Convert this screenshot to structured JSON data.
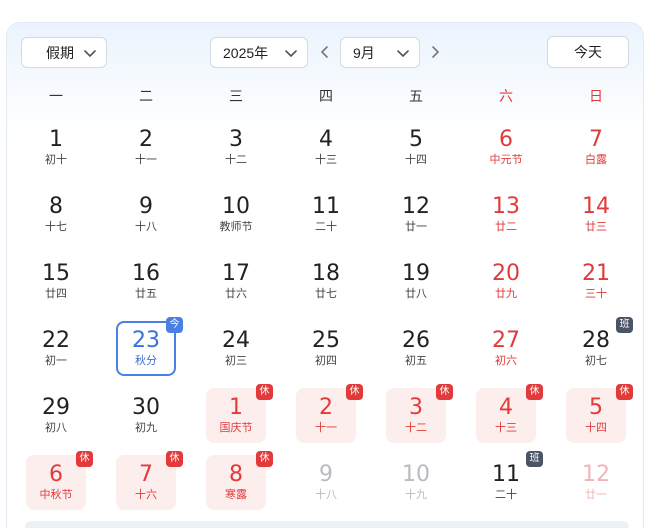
{
  "toolbar": {
    "holiday_label": "假期",
    "year_label": "2025年",
    "month_label": "9月",
    "today_label": "今天"
  },
  "weekdays": [
    "一",
    "二",
    "三",
    "四",
    "五",
    "六",
    "日"
  ],
  "badges": {
    "rest": "休",
    "work": "班",
    "today": "今"
  },
  "weeks": [
    [
      {
        "day": "1",
        "sub": "初十"
      },
      {
        "day": "2",
        "sub": "十一"
      },
      {
        "day": "3",
        "sub": "十二"
      },
      {
        "day": "4",
        "sub": "十三"
      },
      {
        "day": "5",
        "sub": "十四"
      },
      {
        "day": "6",
        "sub": "中元节",
        "red": true
      },
      {
        "day": "7",
        "sub": "白露",
        "red": true
      }
    ],
    [
      {
        "day": "8",
        "sub": "十七"
      },
      {
        "day": "9",
        "sub": "十八"
      },
      {
        "day": "10",
        "sub": "教师节"
      },
      {
        "day": "11",
        "sub": "二十"
      },
      {
        "day": "12",
        "sub": "廿一"
      },
      {
        "day": "13",
        "sub": "廿二",
        "red": true
      },
      {
        "day": "14",
        "sub": "廿三",
        "red": true
      }
    ],
    [
      {
        "day": "15",
        "sub": "廿四"
      },
      {
        "day": "16",
        "sub": "廿五"
      },
      {
        "day": "17",
        "sub": "廿六"
      },
      {
        "day": "18",
        "sub": "廿七"
      },
      {
        "day": "19",
        "sub": "廿八"
      },
      {
        "day": "20",
        "sub": "廿九",
        "red": true
      },
      {
        "day": "21",
        "sub": "三十",
        "red": true
      }
    ],
    [
      {
        "day": "22",
        "sub": "初一"
      },
      {
        "day": "23",
        "sub": "秋分",
        "today": true,
        "badge": "today"
      },
      {
        "day": "24",
        "sub": "初三"
      },
      {
        "day": "25",
        "sub": "初四"
      },
      {
        "day": "26",
        "sub": "初五"
      },
      {
        "day": "27",
        "sub": "初六",
        "red": true
      },
      {
        "day": "28",
        "sub": "初七",
        "badge": "work"
      }
    ],
    [
      {
        "day": "29",
        "sub": "初八"
      },
      {
        "day": "30",
        "sub": "初九"
      },
      {
        "day": "1",
        "sub": "国庆节",
        "red": true,
        "holiday": true,
        "badge": "rest"
      },
      {
        "day": "2",
        "sub": "十一",
        "red": true,
        "holiday": true,
        "badge": "rest"
      },
      {
        "day": "3",
        "sub": "十二",
        "red": true,
        "holiday": true,
        "badge": "rest"
      },
      {
        "day": "4",
        "sub": "十三",
        "red": true,
        "holiday": true,
        "badge": "rest"
      },
      {
        "day": "5",
        "sub": "十四",
        "red": true,
        "holiday": true,
        "badge": "rest"
      }
    ],
    [
      {
        "day": "6",
        "sub": "中秋节",
        "red": true,
        "holiday": true,
        "badge": "rest"
      },
      {
        "day": "7",
        "sub": "十六",
        "red": true,
        "holiday": true,
        "badge": "rest"
      },
      {
        "day": "8",
        "sub": "寒露",
        "red": true,
        "holiday": true,
        "badge": "rest"
      },
      {
        "day": "9",
        "sub": "十八",
        "gray": true
      },
      {
        "day": "10",
        "sub": "十九",
        "gray": true
      },
      {
        "day": "11",
        "sub": "二十",
        "badge": "work"
      },
      {
        "day": "12",
        "sub": "廿一",
        "lred": true
      }
    ]
  ],
  "colors": {
    "accent_blue": "#4a7fe6",
    "holiday_red": "#e23a3a",
    "holiday_bg": "#fdeeee",
    "work_badge": "#4a5568"
  },
  "icons": {
    "dropdown": "chevron-down-icon",
    "prev": "chevron-left-icon",
    "next": "chevron-right-icon"
  }
}
